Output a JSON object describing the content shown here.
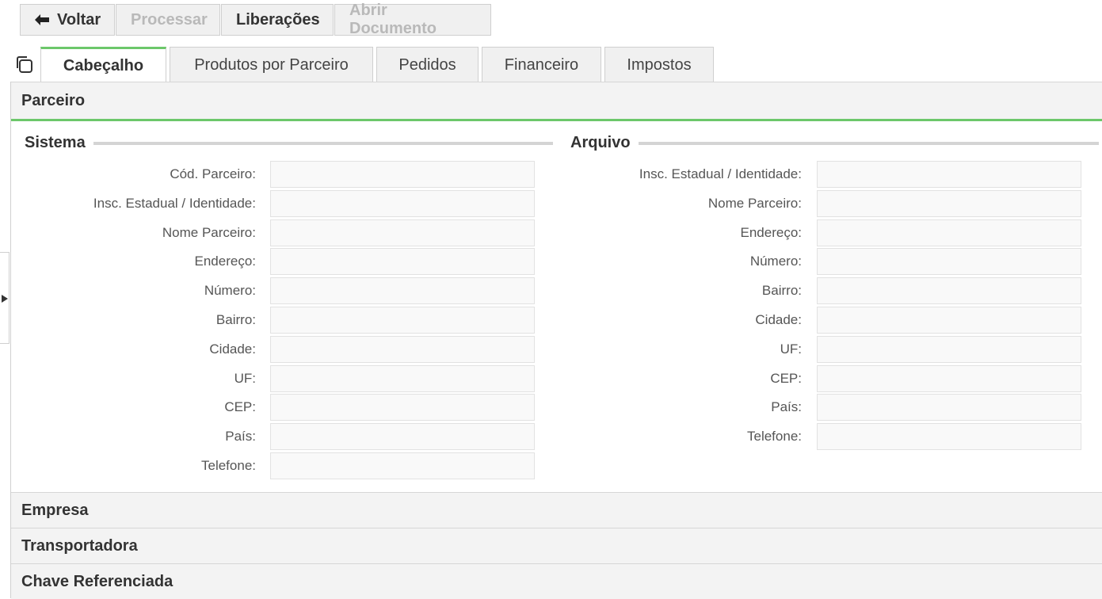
{
  "toolbar": {
    "back_label": "Voltar",
    "process_label": "Processar",
    "releases_label": "Liberações",
    "open_document_label": "Abrir Documento"
  },
  "tabs": [
    {
      "label": "Cabeçalho",
      "active": true
    },
    {
      "label": "Produtos por Parceiro",
      "active": false
    },
    {
      "label": "Pedidos",
      "active": false
    },
    {
      "label": "Financeiro",
      "active": false
    },
    {
      "label": "Impostos",
      "active": false
    }
  ],
  "sections": {
    "parceiro": "Parceiro",
    "empresa": "Empresa",
    "transportadora": "Transportadora",
    "chave_referenciada": "Chave Referenciada"
  },
  "sistema": {
    "title": "Sistema",
    "fields": [
      {
        "label": "Cód. Parceiro:",
        "value": ""
      },
      {
        "label": "Insc. Estadual / Identidade:",
        "value": ""
      },
      {
        "label": "Nome Parceiro:",
        "value": ""
      },
      {
        "label": "Endereço:",
        "value": ""
      },
      {
        "label": "Número:",
        "value": ""
      },
      {
        "label": "Bairro:",
        "value": ""
      },
      {
        "label": "Cidade:",
        "value": ""
      },
      {
        "label": "UF:",
        "value": ""
      },
      {
        "label": "CEP:",
        "value": ""
      },
      {
        "label": "País:",
        "value": ""
      },
      {
        "label": "Telefone:",
        "value": ""
      }
    ]
  },
  "arquivo": {
    "title": "Arquivo",
    "fields": [
      {
        "label": "Insc. Estadual / Identidade:",
        "value": ""
      },
      {
        "label": "Nome Parceiro:",
        "value": ""
      },
      {
        "label": "Endereço:",
        "value": ""
      },
      {
        "label": "Número:",
        "value": ""
      },
      {
        "label": "Bairro:",
        "value": ""
      },
      {
        "label": "Cidade:",
        "value": ""
      },
      {
        "label": "UF:",
        "value": ""
      },
      {
        "label": "CEP:",
        "value": ""
      },
      {
        "label": "País:",
        "value": ""
      },
      {
        "label": "Telefone:",
        "value": ""
      }
    ]
  },
  "colors": {
    "accent": "#6cc76a",
    "header_bg": "#f3f3f3",
    "button_bg": "#f0f0f0",
    "disabled_text": "#b9b9b9"
  }
}
